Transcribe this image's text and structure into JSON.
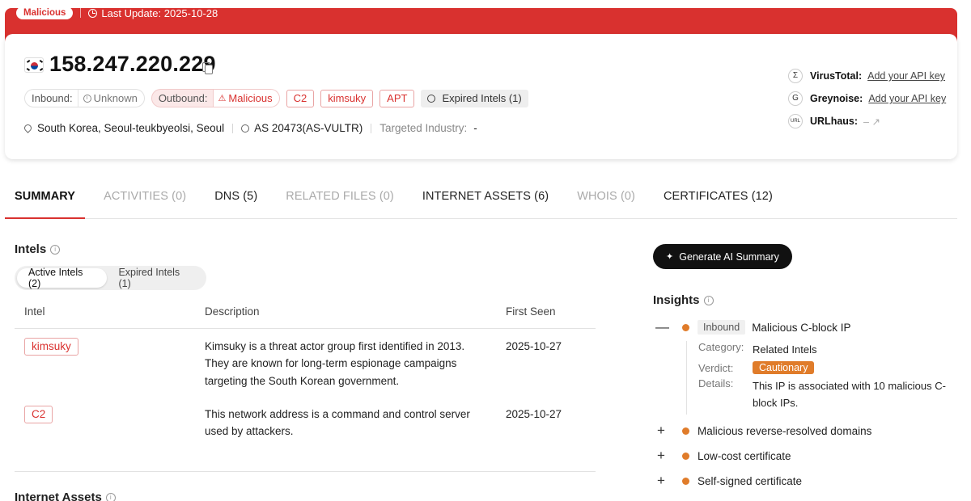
{
  "banner": {
    "status": "Malicious",
    "last_update": "Last Update: 2025-10-28"
  },
  "header": {
    "ip": "158.247.220.229",
    "inbound_label": "Inbound:",
    "inbound_value": "Unknown",
    "outbound_label": "Outbound:",
    "outbound_value": "Malicious",
    "tags": [
      "C2",
      "kimsuky",
      "APT"
    ],
    "expired_intels": "Expired Intels (1)",
    "location": "South Korea, Seoul-teukbyeolsi, Seoul",
    "asn": "AS 20473(AS-VULTR)",
    "industry_label": "Targeted Industry:",
    "industry_value": "-"
  },
  "external": [
    {
      "name": "VirusTotal:",
      "value": "Add your API key",
      "icon": "virustotal-icon"
    },
    {
      "name": "Greynoise:",
      "value": "Add your API key",
      "icon": "greynoise-icon"
    },
    {
      "name": "URLhaus:",
      "value": "– ↗",
      "icon": "urlhaus-icon"
    }
  ],
  "tabs": [
    {
      "label": "SUMMARY",
      "state": "active"
    },
    {
      "label": "ACTIVITIES (0)",
      "state": "dim"
    },
    {
      "label": "DNS (5)",
      "state": "dark"
    },
    {
      "label": "RELATED FILES (0)",
      "state": "dim"
    },
    {
      "label": "INTERNET ASSETS (6)",
      "state": "dark"
    },
    {
      "label": "WHOIS (0)",
      "state": "dim"
    },
    {
      "label": "CERTIFICATES (12)",
      "state": "dark"
    }
  ],
  "intels": {
    "title": "Intels",
    "segments": [
      "Active Intels (2)",
      "Expired Intels (1)"
    ],
    "columns": [
      "Intel",
      "Description",
      "First Seen"
    ],
    "rows": [
      {
        "intel": "kimsuky",
        "description": "Kimsuky is a threat actor group first identified in 2013. They are known for long-term espionage campaigns targeting the South Korean government.",
        "first_seen": "2025-10-27"
      },
      {
        "intel": "C2",
        "description": "This network address is a command and control server used by attackers.",
        "first_seen": "2025-10-27"
      }
    ]
  },
  "internet_assets_title": "Internet Assets",
  "ai_button": "Generate AI Summary",
  "insights": {
    "title": "Insights",
    "expanded": {
      "toggle": "—",
      "chip": "Inbound",
      "title": "Malicious C-block IP",
      "category_label": "Category:",
      "category_value": "Related Intels",
      "verdict_label": "Verdict:",
      "verdict_value": "Cautionary",
      "details_label": "Details:",
      "details_value": "This IP is associated with 10 malicious C-block IPs."
    },
    "items": [
      {
        "toggle": "+",
        "label": "Malicious reverse-resolved domains"
      },
      {
        "toggle": "+",
        "label": "Low-cost certificate"
      },
      {
        "toggle": "+",
        "label": "Self-signed certificate"
      }
    ],
    "dot_color": "#e07c2a"
  },
  "colors": {
    "brand_red": "#d9312f",
    "orange": "#e07c2a"
  }
}
